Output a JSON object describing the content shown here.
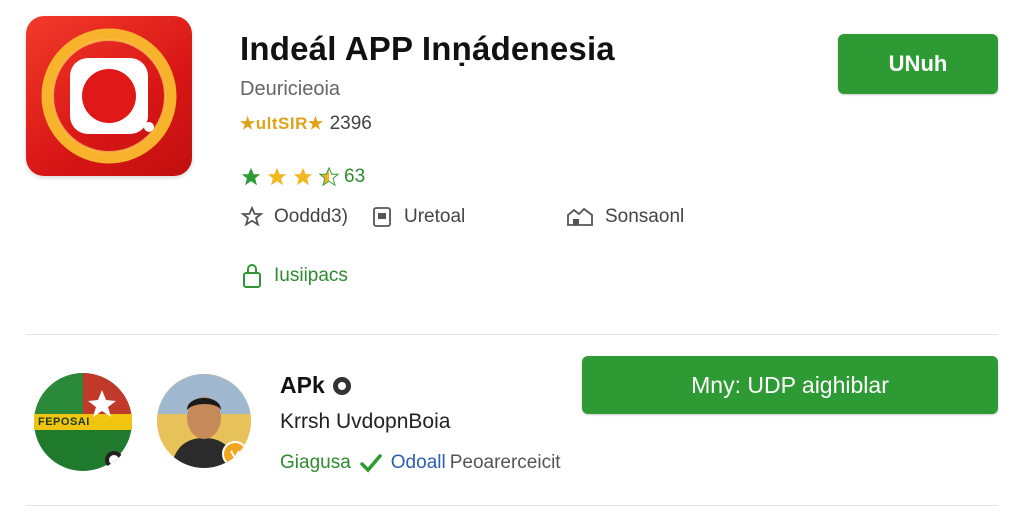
{
  "app": {
    "title": "Indeál APP Inṇádenesia",
    "developer": "Deuricieoia",
    "badge": "★ultSIR★",
    "downloads": "2396",
    "rating_count": "63",
    "rating_stars": 3.5,
    "meta": {
      "reviews": "Ooddd3)",
      "category": "Uretoal",
      "content": "Sonsaonl"
    },
    "permissions": "Iusiipacs",
    "install_label": "UNuh"
  },
  "developer_card": {
    "name": "APk",
    "subtitle": "Krrsh UvdopnBoia",
    "tags": [
      "Giagusa",
      "Odoall",
      "Peoarerceicit"
    ],
    "action_label": "Mny: UDP aighiblar",
    "logo_text": "FEPOSAI"
  },
  "colors": {
    "accent_green": "#2e9a34",
    "icon_red": "#d81616",
    "star_gold": "#f2b61e"
  }
}
